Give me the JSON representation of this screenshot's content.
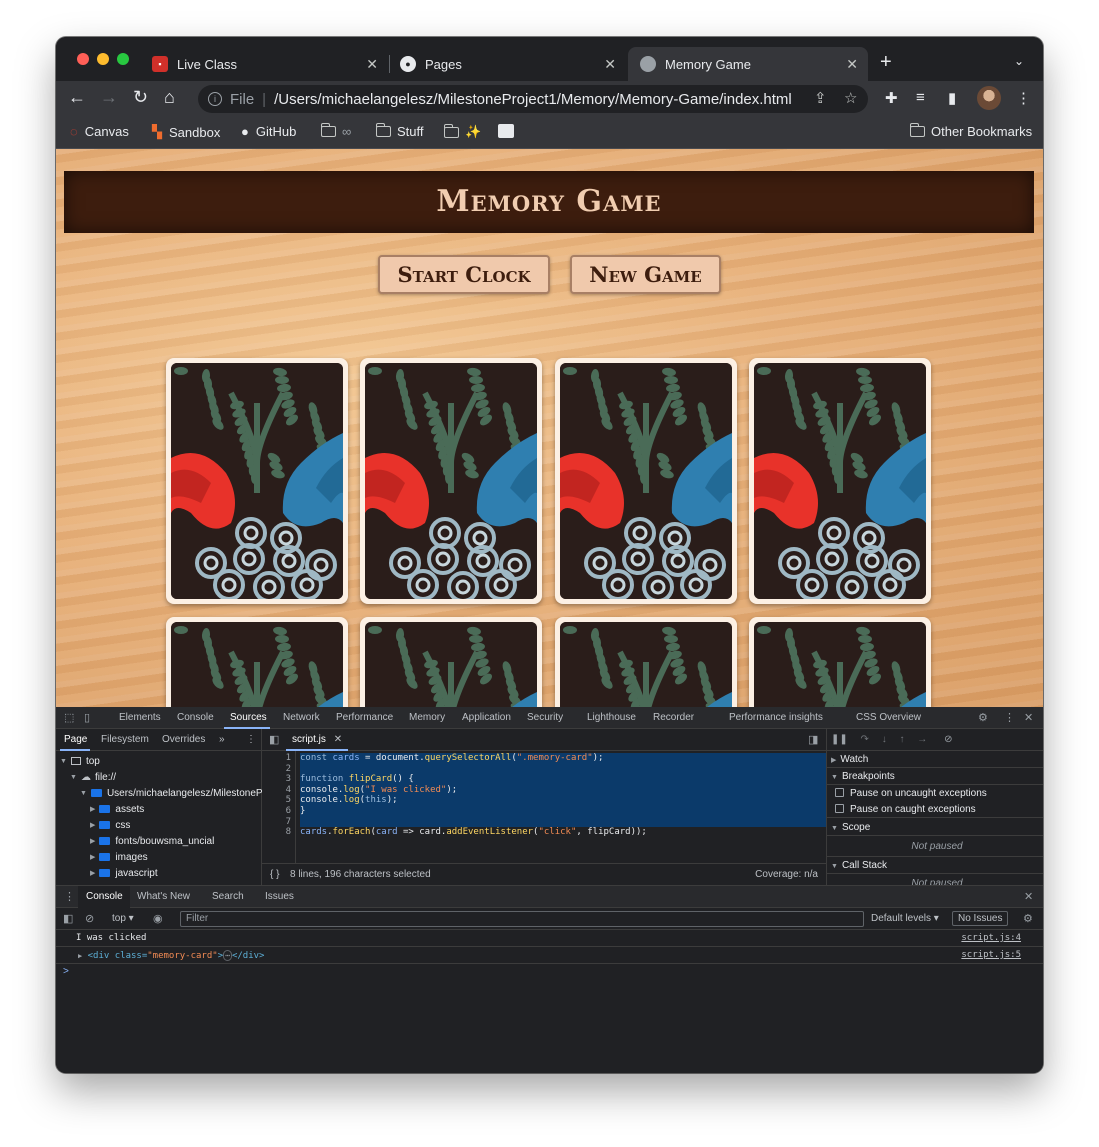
{
  "browser": {
    "tabs": [
      {
        "title": "Live Class",
        "favicon": "live-class-favicon"
      },
      {
        "title": "Pages",
        "favicon": "github-icon"
      },
      {
        "title": "Memory Game",
        "favicon": "globe-icon"
      }
    ],
    "address": {
      "scheme": "File",
      "url": "/Users/michaelangelesz/MilestoneProject1/Memory/Memory-Game/index.html"
    },
    "bookmarks": [
      {
        "label": "Canvas"
      },
      {
        "label": "Sandbox"
      },
      {
        "label": "GitHub"
      },
      {
        "label": "Stuff"
      },
      {
        "label": "Other Bookmarks"
      }
    ]
  },
  "page": {
    "title": "Memory Game",
    "buttons": {
      "start": "Start Clock",
      "new": "New Game"
    },
    "colors": {
      "banner": "#3d1d0e",
      "button": "#f0c9ac",
      "title_text": "#f1cdb0"
    }
  },
  "devtools": {
    "tabs": [
      "Elements",
      "Console",
      "Sources",
      "Network",
      "Performance",
      "Memory",
      "Application",
      "Security",
      "Lighthouse",
      "Recorder",
      "Performance insights",
      "CSS Overview"
    ],
    "active_tab": "Sources",
    "nav_tabs": [
      "Page",
      "Filesystem",
      "Overrides"
    ],
    "tree": {
      "top": "top",
      "origin": "file://",
      "folder": "Users/michaelangelesz/MilestonePro",
      "children": [
        "assets",
        "css",
        "fonts/bouwsma_uncial",
        "images",
        "javascript"
      ]
    },
    "editor": {
      "file": "script.js",
      "line_numbers": [
        "1",
        "2",
        "3",
        "4",
        "5",
        "6",
        "7",
        "8"
      ],
      "status": "8 lines, 196 characters selected",
      "coverage": "Coverage: n/a"
    },
    "debugger": {
      "watch": "Watch",
      "breakpoints": "Breakpoints",
      "pause_uncaught": "Pause on uncaught exceptions",
      "pause_caught": "Pause on caught exceptions",
      "scope": "Scope",
      "scope_status": "Not paused",
      "call_stack": "Call Stack",
      "call_status": "Not paused"
    },
    "drawer": {
      "tabs": [
        "Console",
        "What's New",
        "Search",
        "Issues"
      ],
      "context": "top",
      "filter_placeholder": "Filter",
      "levels": "Default levels",
      "issues": "No Issues",
      "logs": [
        {
          "text": "I was clicked",
          "source": "script.js:4"
        },
        {
          "text_parts": [
            "<div class=",
            "\"memory-card\"",
            ">",
            "⋯",
            "</div>"
          ],
          "source": "script.js:5"
        }
      ],
      "prompt": ">"
    }
  }
}
